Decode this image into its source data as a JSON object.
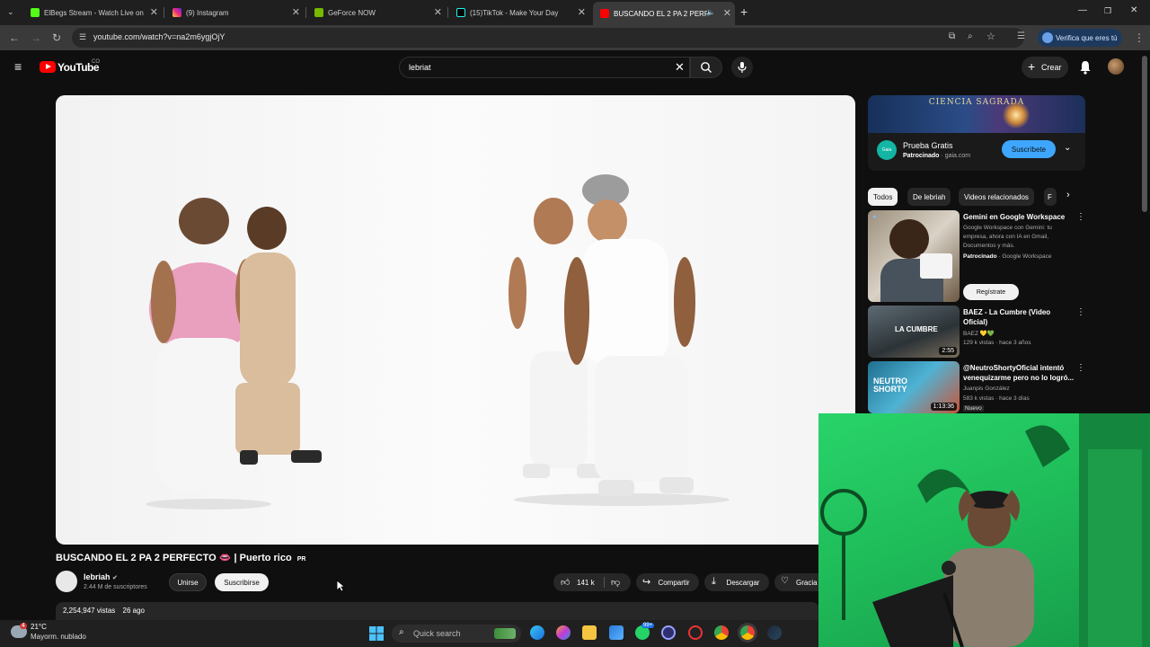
{
  "browser": {
    "tabs": [
      {
        "label": "ElBegs Stream - Watch Live on",
        "color": "#53fc18"
      },
      {
        "label": "(9) Instagram",
        "color": "#e1306c"
      },
      {
        "label": "GeForce NOW",
        "color": "#76b900"
      },
      {
        "label": "(15)TikTok - Make Your Day",
        "color": "#111111"
      },
      {
        "label": "BUSCANDO EL 2 PA 2 PERF",
        "color": "#ff0000"
      }
    ],
    "new_tab": "+",
    "url": "youtube.com/watch?v=na2m6ygjOjY",
    "verify_label": "Verifica que eres tú"
  },
  "youtube": {
    "brand": "YouTube",
    "country": "CO",
    "search_value": "lebriat",
    "create_label": "Crear"
  },
  "video": {
    "title": "BUSCANDO EL 2 PA 2 PERFECTO 👄 | Puerto rico",
    "title_flag": "PR",
    "channel": "lebriah",
    "subscribers": "2.44 M de suscriptores",
    "join_label": "Unirse",
    "subscribe_label": "Suscribirse",
    "likes": "141 k",
    "share_label": "Compartir",
    "download_label": "Descargar",
    "thanks_label": "Gracia",
    "views": "2,254,947 vistas",
    "date": "26 ago"
  },
  "sidebar": {
    "ad": {
      "banner_title": "CIENCIA SAGRADA",
      "logo": "Gaia",
      "title": "Prueba Gratis",
      "sponsored": "Patrocinado",
      "domain": "gaia.com",
      "subscribe_label": "Suscríbete"
    },
    "chips": [
      "Todos",
      "De lebriah",
      "Videos relacionados",
      "F"
    ],
    "recommendations": [
      {
        "title": "Gemini en Google Workspace",
        "line1": "Google Workspace con Gemini: tu",
        "line2": "empresa, ahora con IA en Gmail,",
        "line3": "Documentos y más.",
        "sponsored": "Patrocinado",
        "meta": "· Google Workspace",
        "cta": "Regístrate"
      },
      {
        "title": "BAEZ - La Cumbre (Video Oficial)",
        "channel": "BAEZ 💛💚",
        "meta": "129 k vistas · hace 3 años",
        "duration": "2:55",
        "thumb_text": "LA CUMBRE"
      },
      {
        "title": "@NeutroShortyOficial intentó venequizarme pero no lo logró...",
        "channel": "Juanpis González",
        "meta": "583 k vistas · hace 3 días",
        "badge": "Nuevo",
        "duration": "1:13:36",
        "thumb_text": "NEUTRO SHORTY"
      }
    ]
  },
  "taskbar": {
    "temp": "21°C",
    "weather": "Mayorm. nublado",
    "search_placeholder": "Quick search",
    "notif_count": "4"
  }
}
